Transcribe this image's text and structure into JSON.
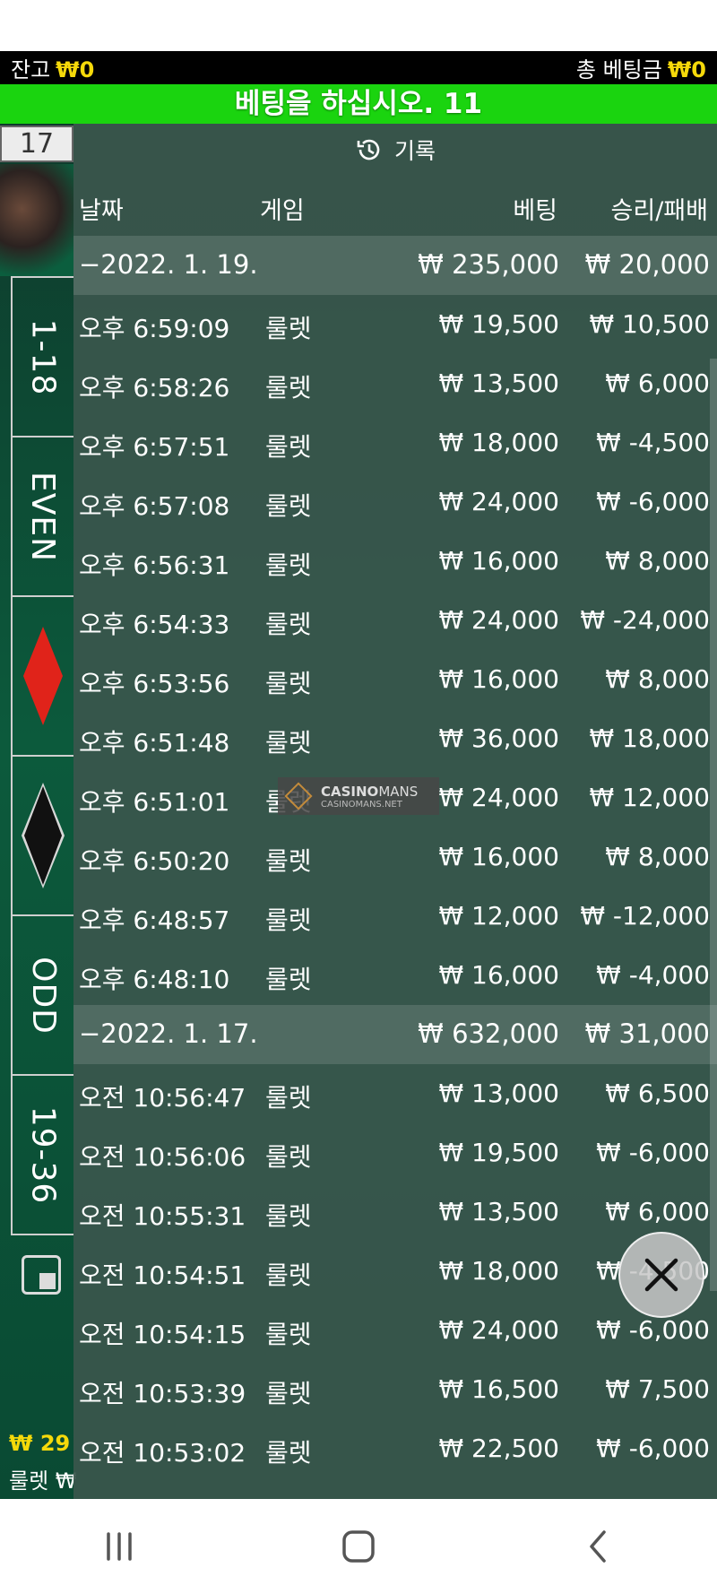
{
  "topbar": {
    "balance_label": "잔고",
    "balance_value": "₩0",
    "total_bet_label": "총 베팅금",
    "total_bet_value": "₩0"
  },
  "bet_banner": "베팅을 하십시오. 11",
  "timer": "17",
  "side_strip": {
    "top": "1-18",
    "even": "EVEN",
    "odd": "ODD",
    "bottom": "19-36"
  },
  "bottom_left": {
    "amount": "₩ 29",
    "game": "룰렛 ₩"
  },
  "history": {
    "title": "기록",
    "columns": {
      "date": "날짜",
      "game": "게임",
      "bet": "베팅",
      "result": "승리/패배"
    },
    "groups": [
      {
        "date": "−2022. 1. 19.",
        "bet": "₩ 235,000",
        "result": "₩ 20,000",
        "rows": [
          {
            "time": "오후 6:59:09",
            "game": "룰렛",
            "bet": "₩ 19,500",
            "result": "₩ 10,500"
          },
          {
            "time": "오후 6:58:26",
            "game": "룰렛",
            "bet": "₩ 13,500",
            "result": "₩ 6,000"
          },
          {
            "time": "오후 6:57:51",
            "game": "룰렛",
            "bet": "₩ 18,000",
            "result": "₩ -4,500"
          },
          {
            "time": "오후 6:57:08",
            "game": "룰렛",
            "bet": "₩ 24,000",
            "result": "₩ -6,000"
          },
          {
            "time": "오후 6:56:31",
            "game": "룰렛",
            "bet": "₩ 16,000",
            "result": "₩ 8,000"
          },
          {
            "time": "오후 6:54:33",
            "game": "룰렛",
            "bet": "₩ 24,000",
            "result": "₩ -24,000"
          },
          {
            "time": "오후 6:53:56",
            "game": "룰렛",
            "bet": "₩ 16,000",
            "result": "₩ 8,000"
          },
          {
            "time": "오후 6:51:48",
            "game": "룰렛",
            "bet": "₩ 36,000",
            "result": "₩ 18,000"
          },
          {
            "time": "오후 6:51:01",
            "game": "룰렛",
            "bet": "₩ 24,000",
            "result": "₩ 12,000"
          },
          {
            "time": "오후 6:50:20",
            "game": "룰렛",
            "bet": "₩ 16,000",
            "result": "₩ 8,000"
          },
          {
            "time": "오후 6:48:57",
            "game": "룰렛",
            "bet": "₩ 12,000",
            "result": "₩ -12,000"
          },
          {
            "time": "오후 6:48:10",
            "game": "룰렛",
            "bet": "₩ 16,000",
            "result": "₩ -4,000"
          }
        ]
      },
      {
        "date": "−2022. 1. 17.",
        "bet": "₩ 632,000",
        "result": "₩ 31,000",
        "rows": [
          {
            "time": "오전 10:56:47",
            "game": "룰렛",
            "bet": "₩ 13,000",
            "result": "₩ 6,500"
          },
          {
            "time": "오전 10:56:06",
            "game": "룰렛",
            "bet": "₩ 19,500",
            "result": "₩ -6,000"
          },
          {
            "time": "오전 10:55:31",
            "game": "룰렛",
            "bet": "₩ 13,500",
            "result": "₩ 6,000"
          },
          {
            "time": "오전 10:54:51",
            "game": "룰렛",
            "bet": "₩ 18,000",
            "result": "₩ -4,500"
          },
          {
            "time": "오전 10:54:15",
            "game": "룰렛",
            "bet": "₩ 24,000",
            "result": "₩ -6,000"
          },
          {
            "time": "오전 10:53:39",
            "game": "룰렛",
            "bet": "₩ 16,500",
            "result": "₩ 7,500"
          },
          {
            "time": "오전 10:53:02",
            "game": "룰렛",
            "bet": "₩ 22,500",
            "result": "₩ -6,000"
          }
        ]
      }
    ]
  },
  "watermark": {
    "brand_bold": "CASINO",
    "brand_rest": "MANS",
    "url": "CASINOMANS.NET"
  },
  "icons": {
    "history": "history-clock-icon",
    "close": "close-icon",
    "recents": "recent-apps-icon",
    "home": "home-icon",
    "back": "back-icon"
  }
}
